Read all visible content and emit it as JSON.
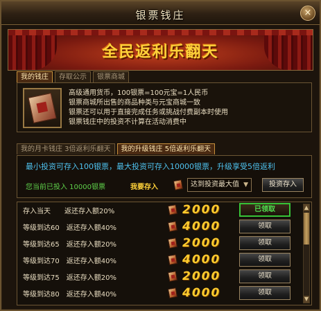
{
  "window": {
    "title": "银票钱庄",
    "close_label": "×"
  },
  "banner": {
    "slogan": "全民返利乐翻天"
  },
  "top_tabs": [
    {
      "label": "我的钱庄",
      "active": true
    },
    {
      "label": "存取公示",
      "active": false
    },
    {
      "label": "银票商城",
      "active": false
    }
  ],
  "info": {
    "lines": [
      "高级通用货币，100银票=100元宝=1人民币",
      "银票商城所出售的商品种类与元宝商城一致",
      "银票还可以用于直接完成任务或挑战付费副本时使用",
      "银票钱庄中的投资不计算在活动消费中"
    ]
  },
  "sub_tabs": [
    {
      "label": "我的月卡钱庄 3倍返利乐翻天",
      "active": false
    },
    {
      "label": "我的升级钱庄 5倍返利乐翻天",
      "active": true
    }
  ],
  "invest": {
    "description": "最小投资可存入100银票，最大投资可存入10000银票，升级享受5倍返利",
    "invested_text": "您当前已投入 10000银票",
    "want_label": "我要存入",
    "select_value": "达到投资最大值",
    "submit_label": "投资存入"
  },
  "rows": [
    {
      "condition": "存入当天　　返还存入额20%",
      "amount": "2000",
      "button": "已领取",
      "claimed": true
    },
    {
      "condition": "等级到达60　返还存入额40%",
      "amount": "4000",
      "button": "领取",
      "claimed": false
    },
    {
      "condition": "等级到达65　返还存入额20%",
      "amount": "2000",
      "button": "领取",
      "claimed": false
    },
    {
      "condition": "等级到达70　返还存入额40%",
      "amount": "4000",
      "button": "领取",
      "claimed": false
    },
    {
      "condition": "等级到达75　返还存入额20%",
      "amount": "2000",
      "button": "领取",
      "claimed": false
    },
    {
      "condition": "等级到达80　返还存入额40%",
      "amount": "4000",
      "button": "领取",
      "claimed": false
    }
  ],
  "colors": {
    "accent_gold": "#ffcc2e",
    "info_blue": "#4fc3f0",
    "invested_green": "#5ed04a",
    "claimed_green": "#38c438"
  }
}
